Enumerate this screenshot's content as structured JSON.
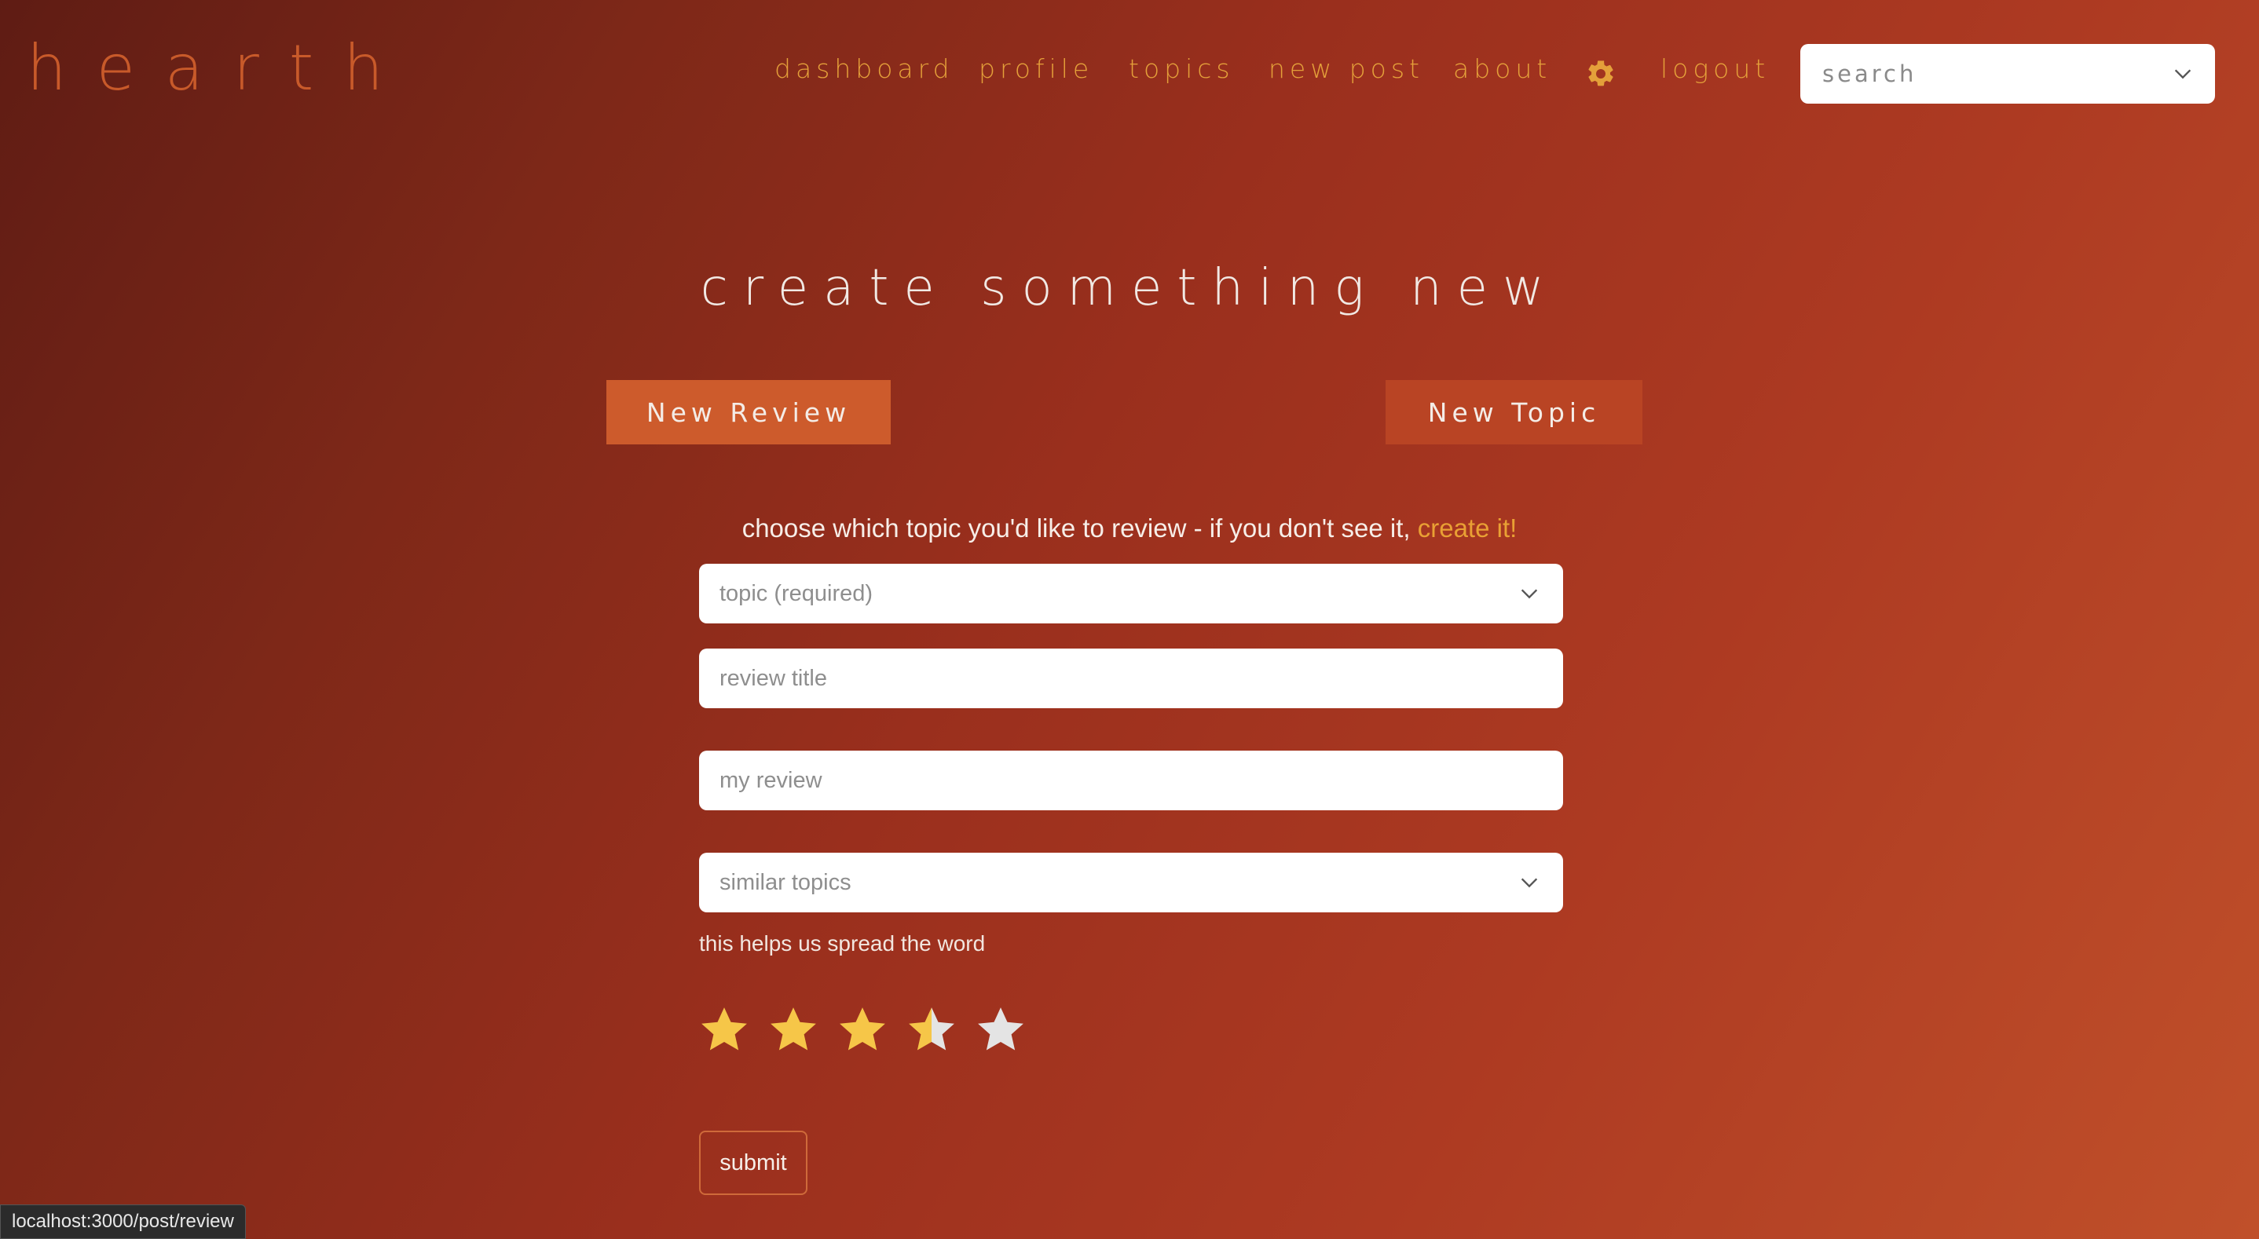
{
  "app": {
    "logo": "hearth"
  },
  "nav": {
    "items": [
      "dashboard",
      "profile",
      "topics",
      "new post",
      "about",
      "logout"
    ],
    "settings_icon": "gear-icon"
  },
  "search": {
    "placeholder": "search"
  },
  "page": {
    "title": "create something new"
  },
  "tabs": {
    "review": "New Review",
    "topic": "New Topic"
  },
  "prompt": {
    "text": "choose which topic you'd like to review - if you don't see it,",
    "link": "create it!"
  },
  "form": {
    "topic_placeholder": "topic (required)",
    "title_placeholder": "review title",
    "review_placeholder": "my review",
    "similar_placeholder": "similar topics",
    "hint": "this helps us spread the word",
    "rating": 3.5,
    "rating_max": 5,
    "submit_label": "submit"
  },
  "colors": {
    "accent": "#e4a03a",
    "star_filled": "#f6c648",
    "star_empty": "#e4e4e4",
    "tab_active": "#cd5b2c",
    "tab_inactive": "#b94424"
  },
  "status_bar": {
    "url": "localhost:3000/post/review"
  }
}
